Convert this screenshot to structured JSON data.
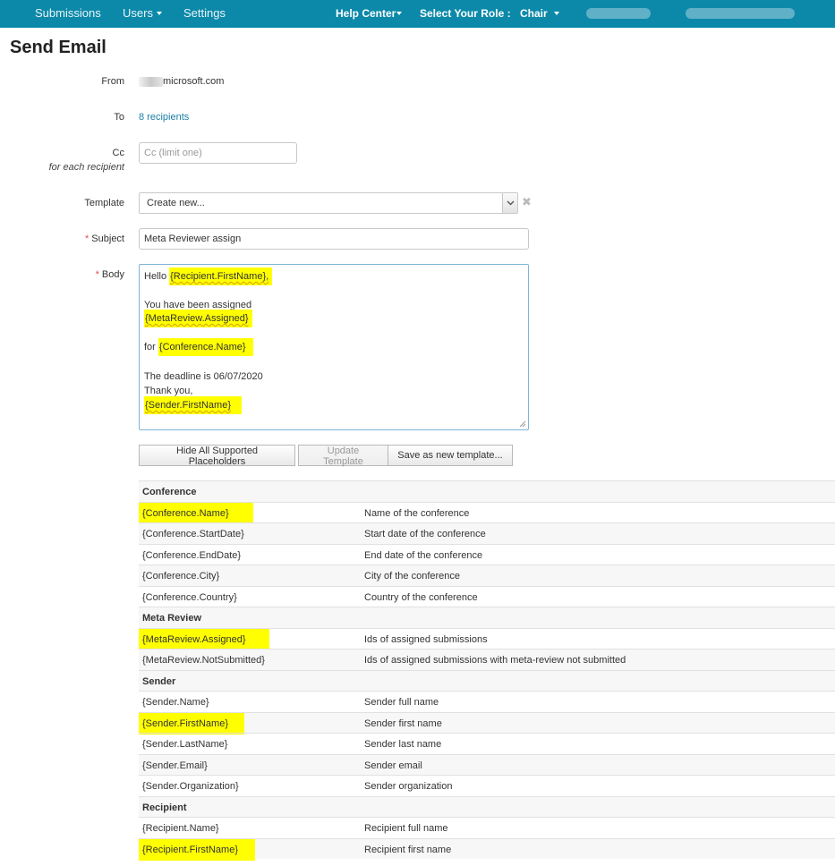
{
  "nav": {
    "submissions": "Submissions",
    "users": "Users",
    "settings": "Settings",
    "help_center": "Help Center",
    "role_label": "Select Your Role :",
    "role_value": "Chair"
  },
  "page": {
    "title": "Send Email"
  },
  "form": {
    "from_label": "From",
    "from_value": "microsoft.com",
    "to_label": "To",
    "to_value": "8 recipients",
    "cc_label": "Cc",
    "cc_sublabel": "for each recipient",
    "cc_placeholder": "Cc (limit one)",
    "template_label": "Template",
    "template_value": "Create new...",
    "subject_label": "Subject",
    "subject_value": "Meta Reviewer assign",
    "body_label": "Body",
    "required_mark": "*",
    "clear_symbol": "✖"
  },
  "body": {
    "hello": "Hello ",
    "ph_recipient_firstname": "{Recipient.FirstName},",
    "assigned_text": "You have been assigned",
    "ph_metareview_assigned": "{MetaReview.Assigned}",
    "for_text": "for ",
    "ph_conference_name": "{Conference.Name}",
    "deadline": "The deadline is 06/07/2020",
    "thanks": "Thank you,",
    "ph_sender_firstname": "{Sender.FirstName}"
  },
  "buttons": {
    "hide_placeholders": "Hide All Supported Placeholders",
    "update_template": "Update Template",
    "save_new_template": "Save as new template..."
  },
  "placeholders": {
    "conference": {
      "title": "Conference",
      "rows": [
        {
          "key": "{Conference.Name}",
          "desc": "Name of the conference"
        },
        {
          "key": "{Conference.StartDate}",
          "desc": "Start date of the conference"
        },
        {
          "key": "{Conference.EndDate}",
          "desc": "End date of the conference"
        },
        {
          "key": "{Conference.City}",
          "desc": "City of the conference"
        },
        {
          "key": "{Conference.Country}",
          "desc": "Country of the conference"
        }
      ]
    },
    "meta_review": {
      "title": "Meta Review",
      "rows": [
        {
          "key": "{MetaReview.Assigned}",
          "desc": "Ids of assigned submissions"
        },
        {
          "key": "{MetaReview.NotSubmitted}",
          "desc": "Ids of assigned submissions with meta-review not submitted"
        }
      ]
    },
    "sender": {
      "title": "Sender",
      "rows": [
        {
          "key": "{Sender.Name}",
          "desc": "Sender full name"
        },
        {
          "key": "{Sender.FirstName}",
          "desc": "Sender first name"
        },
        {
          "key": "{Sender.LastName}",
          "desc": "Sender last name"
        },
        {
          "key": "{Sender.Email}",
          "desc": "Sender email"
        },
        {
          "key": "{Sender.Organization}",
          "desc": "Sender organization"
        }
      ]
    },
    "recipient": {
      "title": "Recipient",
      "rows": [
        {
          "key": "{Recipient.Name}",
          "desc": "Recipient full name"
        },
        {
          "key": "{Recipient.FirstName}",
          "desc": "Recipient first name"
        }
      ]
    }
  },
  "colors": {
    "navbar": "#0c89a9",
    "link": "#1a7fa6",
    "highlight": "#ffff00",
    "required": "#d9534f"
  }
}
